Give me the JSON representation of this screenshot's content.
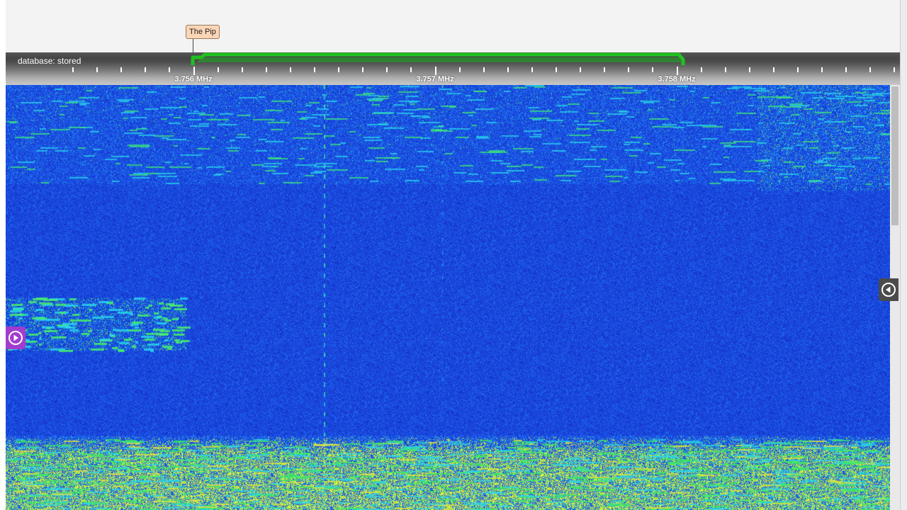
{
  "marker": {
    "label": "The Pip"
  },
  "scale": {
    "database_label": "database: stored",
    "frequency_labels": [
      "3.756 MHz",
      "3.757 MHz",
      "3.758 MHz"
    ],
    "passband_color": "#22c722"
  },
  "colors": {
    "waterfall_base": "#1a3fdc",
    "signal_cyan": "#25d3f0",
    "signal_green": "#2ee65c",
    "signal_yellow": "#e6e62a"
  },
  "navigation": {
    "left_icon": "play-circle-icon",
    "right_icon": "back-circle-icon"
  }
}
